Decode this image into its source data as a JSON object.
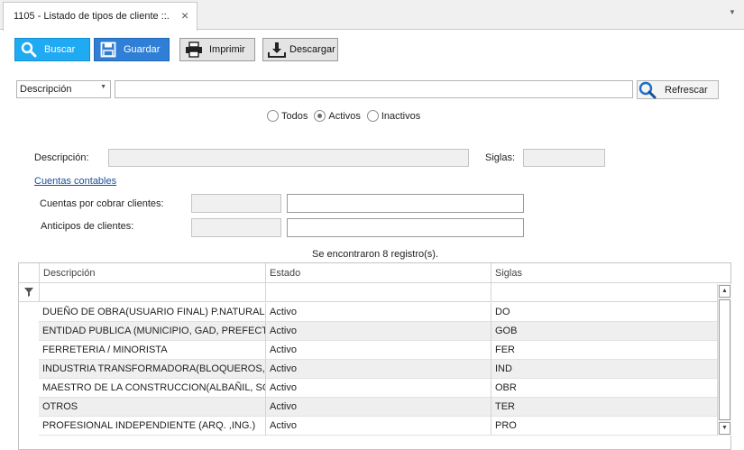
{
  "tab": {
    "title": "1105 - Listado de tipos de cliente ::.",
    "close": "×",
    "menu": "▼"
  },
  "toolbar": {
    "buscar": "Buscar",
    "guardar": "Guardar",
    "imprimir": "Imprimir",
    "descargar": "Descargar"
  },
  "search": {
    "field_selected": "Descripción",
    "query": "",
    "refresh": "Refrescar",
    "dropdown_arrow": "▼"
  },
  "filter": {
    "options": [
      "Todos",
      "Activos",
      "Inactivos"
    ],
    "selected": "Activos"
  },
  "form": {
    "descripcion_label": "Descripción:",
    "descripcion_value": "",
    "siglas_label": "Siglas:",
    "siglas_value": "",
    "cuentas_link": "Cuentas contables",
    "cobrar_label": "Cuentas por cobrar clientes:",
    "cobrar_code": "",
    "cobrar_name": "",
    "anticipos_label": "Anticipos de clientes:",
    "anticipos_code": "",
    "anticipos_name": ""
  },
  "result_count": "Se encontraron 8 registro(s).",
  "grid": {
    "columns": [
      "Descripción",
      "Estado",
      "Siglas"
    ],
    "rows": [
      {
        "descripcion": "DUEÑO DE OBRA(USUARIO FINAL) P.NATURAL ...",
        "estado": "Activo",
        "siglas": "DO"
      },
      {
        "descripcion": "ENTIDAD PUBLICA (MUNICIPIO, GAD, PREFECT...",
        "estado": "Activo",
        "siglas": "GOB"
      },
      {
        "descripcion": "FERRETERIA / MINORISTA",
        "estado": "Activo",
        "siglas": "FER"
      },
      {
        "descripcion": "INDUSTRIA TRANSFORMADORA(BLOQUEROS,H...",
        "estado": "Activo",
        "siglas": "IND"
      },
      {
        "descripcion": "MAESTRO DE LA CONSTRUCCION(ALBAÑIL, SO...",
        "estado": "Activo",
        "siglas": "OBR"
      },
      {
        "descripcion": "OTROS",
        "estado": "Activo",
        "siglas": "TER"
      },
      {
        "descripcion": "PROFESIONAL INDEPENDIENTE (ARQ. ,ING.)",
        "estado": "Activo",
        "siglas": "PRO"
      }
    ]
  },
  "icons": {
    "buscar": "search-icon",
    "guardar": "save-icon",
    "imprimir": "printer-icon",
    "descargar": "download-icon",
    "filter": "filter-icon"
  },
  "colors": {
    "buscar_bg": "#1faaf2",
    "guardar_bg": "#2f7fd6",
    "link": "#1a4f9a",
    "alt_row": "#efefef"
  }
}
